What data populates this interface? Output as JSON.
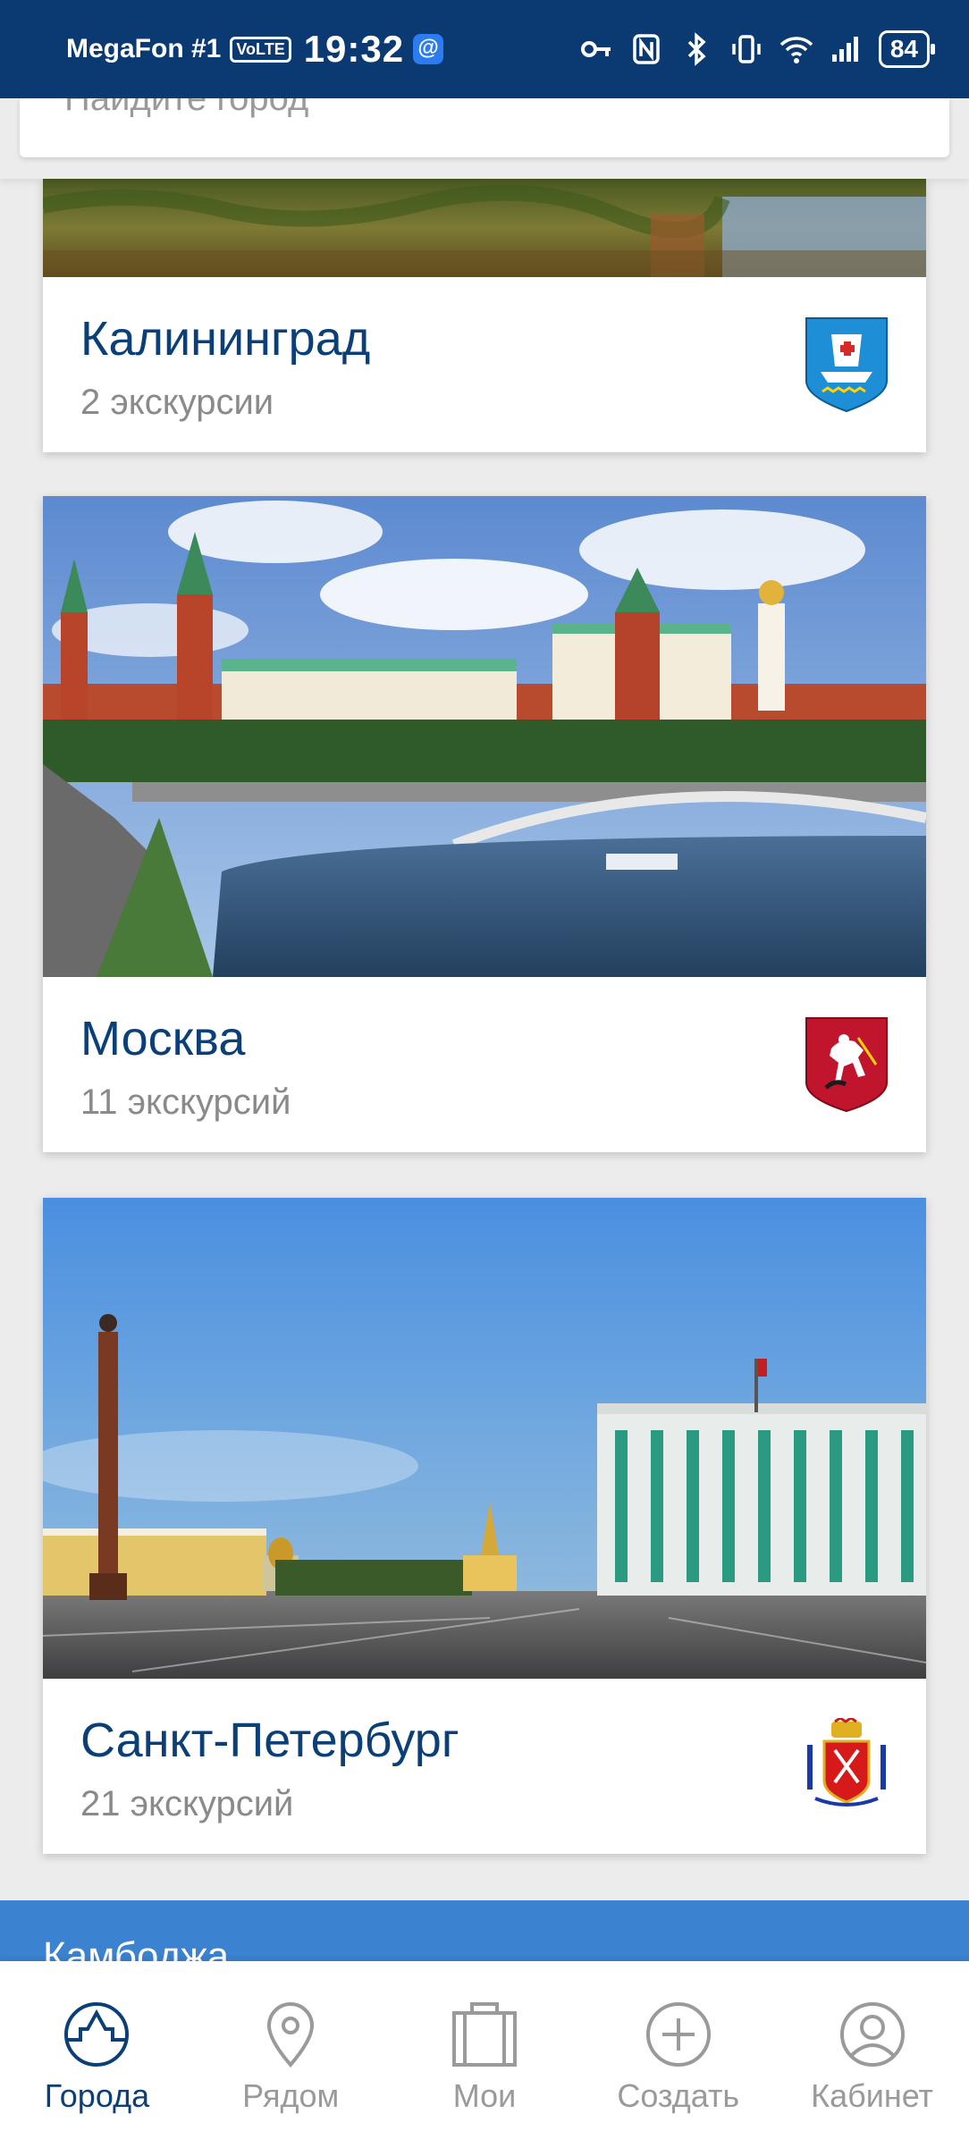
{
  "status_bar": {
    "carrier": "MegaFon #1",
    "volte": "VoLTE",
    "time": "19:32",
    "app_badge": "@",
    "battery": "84"
  },
  "search": {
    "placeholder": "Найдите город"
  },
  "cities": [
    {
      "name": "Калининград",
      "count": "2 экскурсии",
      "coat_icon": "kaliningrad-coat-of-arms-icon"
    },
    {
      "name": "Москва",
      "count": "11 экскурсий",
      "coat_icon": "moscow-coat-of-arms-icon"
    },
    {
      "name": "Санкт-Петербург",
      "count": "21 экскурсий",
      "coat_icon": "spb-coat-of-arms-icon"
    }
  ],
  "next_section": {
    "label": "Камбоджа"
  },
  "nav": {
    "items": [
      {
        "label": "Города",
        "icon": "cities-icon",
        "active": true
      },
      {
        "label": "Рядом",
        "icon": "location-pin-icon",
        "active": false
      },
      {
        "label": "Мои",
        "icon": "suitcase-icon",
        "active": false
      },
      {
        "label": "Создать",
        "icon": "plus-circle-icon",
        "active": false
      },
      {
        "label": "Кабинет",
        "icon": "user-icon",
        "active": false
      }
    ]
  },
  "colors": {
    "status_bar": "#0b3a72",
    "accent": "#0b3f78",
    "section_strip": "#3b82d0",
    "muted": "#9a9a9a"
  }
}
